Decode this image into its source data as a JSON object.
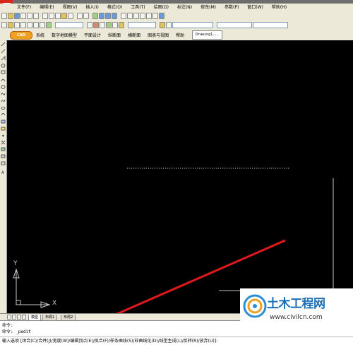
{
  "menubar": {
    "items": [
      "文件(F)",
      "编辑(E)",
      "视图(V)",
      "插入(I)",
      "格式(O)",
      "工具(T)",
      "绘图(D)",
      "标注(N)",
      "修改(M)",
      "参数(P)",
      "窗口(W)",
      "帮助(H)"
    ]
  },
  "tabbar": {
    "logo_text": "CAD",
    "items": [
      "系统",
      "数字地图模型",
      "平面设计",
      "纵断面",
      "横断面",
      "图表与视图",
      "帮助"
    ],
    "drawing_tab": "Drawing1..."
  },
  "modeltabs": [
    "模型",
    "布局1",
    "布局2"
  ],
  "ucs": {
    "y_label": "Y",
    "x_label": "X"
  },
  "command": {
    "history": [
      "命令:",
      "命令: _pedit"
    ],
    "prompt": "输入选项 [闭合(C)/合并(J)/宽度(W)/编辑顶点(E)/拟合(F)/样条曲线(S)/非曲线化(D)/线型生成(L)/反转(R)/放弃(U)]:"
  },
  "watermark": {
    "brand": "土木工程网",
    "url": "www.civilcn.com"
  },
  "colors": {
    "canvas": "#000000",
    "annotation_arrow": "#e01a1a",
    "watermark_brand": "#1d6fb5"
  }
}
